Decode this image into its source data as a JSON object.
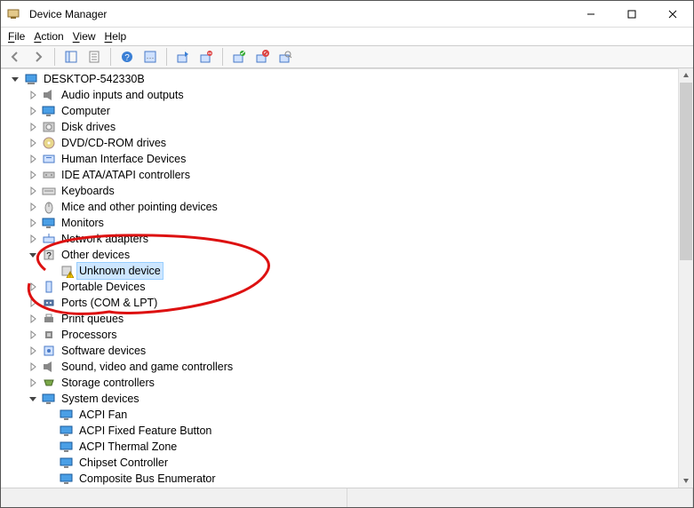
{
  "window": {
    "title": "Device Manager"
  },
  "menu": {
    "file": "File",
    "action": "Action",
    "view": "View",
    "help": "Help"
  },
  "root": "DESKTOP-542330B",
  "nodes": [
    {
      "label": "Audio inputs and outputs",
      "icon": "audio",
      "expanded": false
    },
    {
      "label": "Computer",
      "icon": "monitor",
      "expanded": false
    },
    {
      "label": "Disk drives",
      "icon": "disk",
      "expanded": false
    },
    {
      "label": "DVD/CD-ROM drives",
      "icon": "cd",
      "expanded": false
    },
    {
      "label": "Human Interface Devices",
      "icon": "hid",
      "expanded": false
    },
    {
      "label": "IDE ATA/ATAPI controllers",
      "icon": "ide",
      "expanded": false
    },
    {
      "label": "Keyboards",
      "icon": "keyboard",
      "expanded": false
    },
    {
      "label": "Mice and other pointing devices",
      "icon": "mouse",
      "expanded": false
    },
    {
      "label": "Monitors",
      "icon": "monitor",
      "expanded": false
    },
    {
      "label": "Network adapters",
      "icon": "net",
      "expanded": false
    },
    {
      "label": "Other devices",
      "icon": "other",
      "expanded": true,
      "children": [
        {
          "label": "Unknown device",
          "icon": "warn",
          "selected": true
        }
      ]
    },
    {
      "label": "Portable Devices",
      "icon": "portable",
      "expanded": false
    },
    {
      "label": "Ports (COM & LPT)",
      "icon": "port",
      "expanded": false
    },
    {
      "label": "Print queues",
      "icon": "print",
      "expanded": false
    },
    {
      "label": "Processors",
      "icon": "cpu",
      "expanded": false
    },
    {
      "label": "Software devices",
      "icon": "soft",
      "expanded": false
    },
    {
      "label": "Sound, video and game controllers",
      "icon": "audio",
      "expanded": false
    },
    {
      "label": "Storage controllers",
      "icon": "storage",
      "expanded": false
    },
    {
      "label": "System devices",
      "icon": "monitor",
      "expanded": true,
      "children": [
        {
          "label": "ACPI Fan",
          "icon": "monitor"
        },
        {
          "label": "ACPI Fixed Feature Button",
          "icon": "monitor"
        },
        {
          "label": "ACPI Thermal Zone",
          "icon": "monitor"
        },
        {
          "label": "Chipset Controller",
          "icon": "monitor"
        },
        {
          "label": "Composite Bus Enumerator",
          "icon": "monitor"
        }
      ]
    }
  ]
}
